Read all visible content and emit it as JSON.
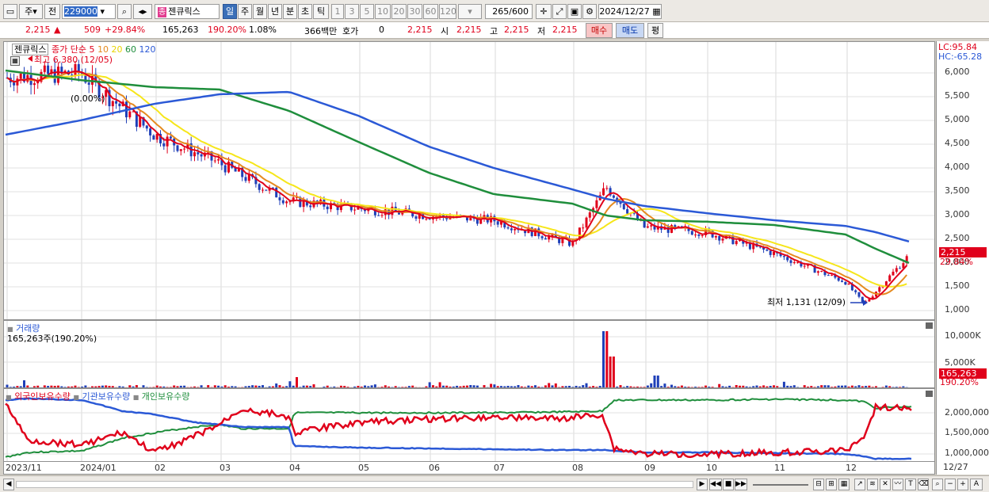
{
  "toolbar": {
    "period_type": "주",
    "compare": "전",
    "code": "229000",
    "market_badge": "종",
    "stock_name": "젠큐릭스",
    "periods": [
      "일",
      "주",
      "월",
      "년",
      "분",
      "초",
      "틱"
    ],
    "active_period": "일",
    "minute_options": [
      "1",
      "3",
      "5",
      "10",
      "20",
      "30",
      "60",
      "120"
    ],
    "count_current": "265",
    "count_total": "/600",
    "date": "2024/12/27"
  },
  "quote": {
    "price": "2,215",
    "change": "509",
    "change_pct": "+29.84%",
    "volume": "165,263",
    "volume_ratio": "190.20%",
    "turnover": "1.08%",
    "amount": "366백만",
    "bid_label": "호가",
    "bid_value": "0",
    "last": "2,215",
    "open_label": "시",
    "open": "2,215",
    "high_label": "고",
    "high": "2,215",
    "low_label": "저",
    "low": "2,215",
    "buy_label": "매수",
    "sell_label": "매도",
    "avg_label": "평"
  },
  "price_pane": {
    "stock_label": "젠큐릭스",
    "ma_title": "종가 단순",
    "ma_periods": [
      "5",
      "10",
      "20",
      "60",
      "120"
    ],
    "ma_colors": [
      "#e0001b",
      "#e58a1f",
      "#f6e61a",
      "#1f8e3c",
      "#2b59d6"
    ],
    "high_marker": "최고 6,380 (12/05)",
    "pct_marker": "(0.00%)",
    "low_marker": "최저 1,131 (12/09)",
    "lc": "LC:95.84",
    "hc": "HC:-65.28",
    "price_tag": "2,215",
    "pct_tag": "29.84%",
    "y_ticks": [
      "6,000",
      "5,500",
      "5,000",
      "4,500",
      "4,000",
      "3,500",
      "3,000",
      "2,500",
      "2,000",
      "1,500",
      "1,000"
    ]
  },
  "volume_pane": {
    "title": "거래량",
    "value": "165,263주(190.20%)",
    "y_ticks": [
      "10,000K",
      "5,000K"
    ],
    "tag_value": "165,263",
    "tag_pct": "190.20%"
  },
  "holding_pane": {
    "series": [
      {
        "name": "외국인보유수량",
        "color": "#e0001b"
      },
      {
        "name": "기관보유수량",
        "color": "#2b59d6"
      },
      {
        "name": "개인보유수량",
        "color": "#1f8e3c"
      }
    ],
    "y_ticks": [
      "2,000,000",
      "1,500,000",
      "1,000,000"
    ]
  },
  "date_axis": {
    "labels": [
      "2023/11",
      "2024/01",
      "02",
      "03",
      "04",
      "05",
      "06",
      "07",
      "08",
      "09",
      "10",
      "11",
      "12"
    ],
    "end_label": "12/27"
  },
  "chart_data": {
    "type": "line",
    "title": "젠큐릭스",
    "ylim": [
      1000,
      6380
    ],
    "candles_trend": [
      {
        "date": "2023/11",
        "price": 5900
      },
      {
        "date": "2024/01",
        "price": 6000
      },
      {
        "date": "02",
        "price": 4700
      },
      {
        "date": "03",
        "price": 4100
      },
      {
        "date": "04",
        "price": 3300
      },
      {
        "date": "05",
        "price": 3150
      },
      {
        "date": "06",
        "price": 3000
      },
      {
        "date": "07",
        "price": 2900
      },
      {
        "date": "08",
        "price": 2400
      },
      {
        "date": "08/20",
        "price": 3600
      },
      {
        "date": "09",
        "price": 2750
      },
      {
        "date": "10",
        "price": 2650
      },
      {
        "date": "11",
        "price": 2200
      },
      {
        "date": "12",
        "price": 1600
      },
      {
        "date": "12/09",
        "price": 1131
      },
      {
        "date": "12/27",
        "price": 2215
      }
    ],
    "series": [
      {
        "name": "120",
        "values": [
          4700,
          5000,
          5350,
          5550,
          5600,
          5100,
          4450,
          4000,
          3550,
          3350,
          3200,
          3050,
          2900,
          2780,
          2650,
          2440
        ]
      },
      {
        "name": "60",
        "values": [
          6050,
          5850,
          5700,
          5650,
          5200,
          4550,
          3900,
          3450,
          3250,
          3000,
          2900,
          2870,
          2800,
          2600,
          2300,
          1980
        ]
      },
      {
        "name": "20",
        "values": [
          5900,
          5800,
          5700,
          5200,
          4350,
          3600,
          3050,
          3000,
          2850,
          2650,
          2900,
          2750,
          2500,
          2050,
          1700,
          1400
        ]
      }
    ]
  }
}
